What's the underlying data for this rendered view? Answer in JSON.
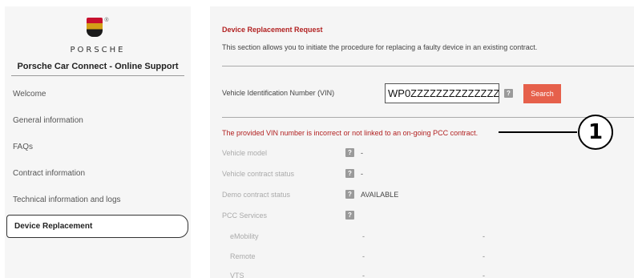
{
  "brand": {
    "reg_mark": "®",
    "wordmark": "PORSCHE",
    "title": "Porsche Car Connect - Online Support"
  },
  "sidebar": {
    "items": [
      {
        "label": "Welcome"
      },
      {
        "label": "General information"
      },
      {
        "label": "FAQs"
      },
      {
        "label": "Contract information"
      },
      {
        "label": "Technical information and logs"
      },
      {
        "label": "Device Replacement",
        "active": true
      }
    ]
  },
  "main": {
    "title": "Device Replacement Request",
    "description": "This section allows you to initiate the procedure for replacing a faulty device in an existing contract.",
    "vin": {
      "label": "Vehicle Identification Number (VIN)",
      "value": "WP0ZZZZZZZZZZZZZZ",
      "help": "?"
    },
    "search_label": "Search",
    "error": "The provided VIN number is incorrect or not linked to an on-going PCC contract.",
    "fields": [
      {
        "label": "Vehicle model",
        "help": "?",
        "value": "-"
      },
      {
        "label": "Vehicle contract status",
        "help": "?",
        "value": "-"
      },
      {
        "label": "Demo contract status",
        "help": "?",
        "value": "AVAILABLE"
      },
      {
        "label": "PCC Services",
        "help": "?",
        "value": ""
      }
    ],
    "services": [
      {
        "label": "eMobility",
        "col1": "-",
        "col2": "-"
      },
      {
        "label": "Remote",
        "col1": "-",
        "col2": "-"
      },
      {
        "label": "VTS",
        "col1": "-",
        "col2": "-"
      }
    ]
  },
  "callout": {
    "number": "1"
  },
  "colors": {
    "accent_red": "#b22222",
    "search_button": "#e6604b"
  }
}
